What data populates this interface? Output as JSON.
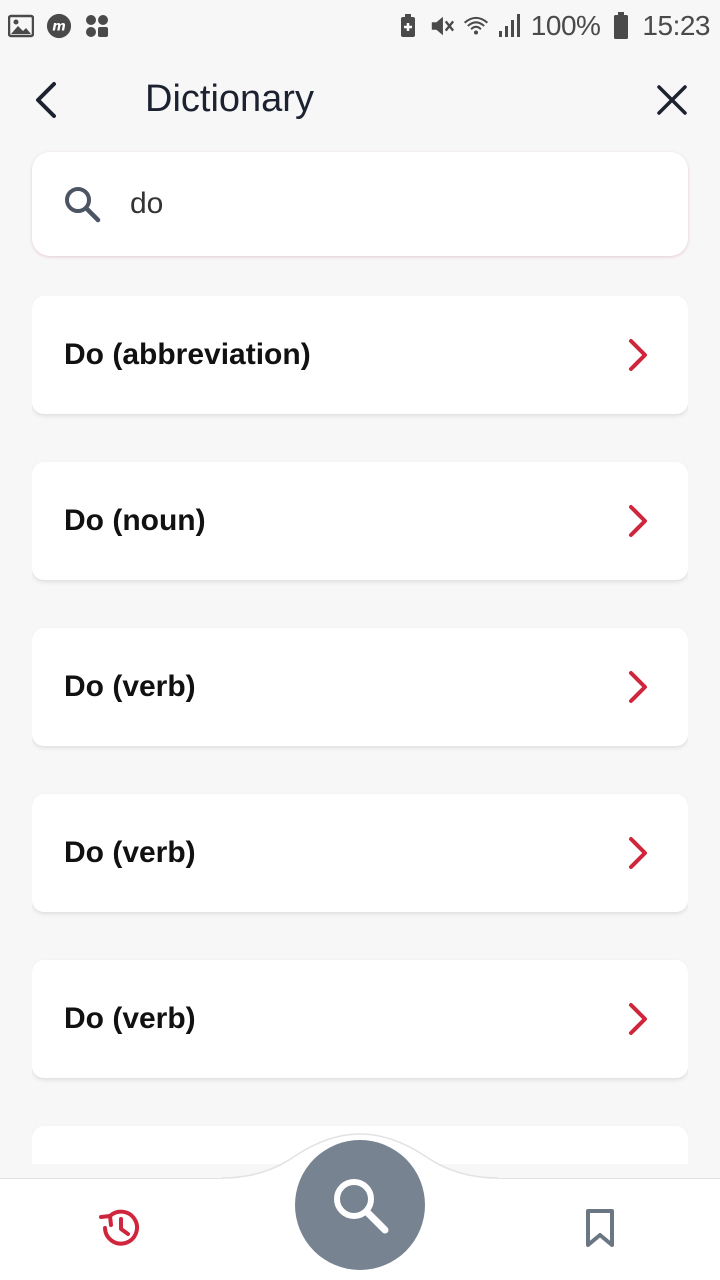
{
  "status_bar": {
    "battery_percent": "100%",
    "time": "15:23",
    "left_icons": [
      "gallery-icon",
      "m-app-icon",
      "apps-dots-icon"
    ],
    "right_icons": [
      "battery-saver-icon",
      "mute-icon",
      "wifi-icon",
      "signal-icon",
      "battery-icon"
    ]
  },
  "header": {
    "title": "Dictionary"
  },
  "search": {
    "value": "do",
    "placeholder": ""
  },
  "results": [
    {
      "label": "Do (abbreviation)"
    },
    {
      "label": "Do (noun)"
    },
    {
      "label": "Do (verb)"
    },
    {
      "label": "Do (verb)"
    },
    {
      "label": "Do (verb)"
    }
  ],
  "colors": {
    "accent": "#d0263d",
    "fab": "#778391",
    "bookmark": "#6b7683"
  },
  "bottom_nav": {
    "items": [
      "history-icon",
      "search-icon",
      "bookmark-icon"
    ]
  }
}
